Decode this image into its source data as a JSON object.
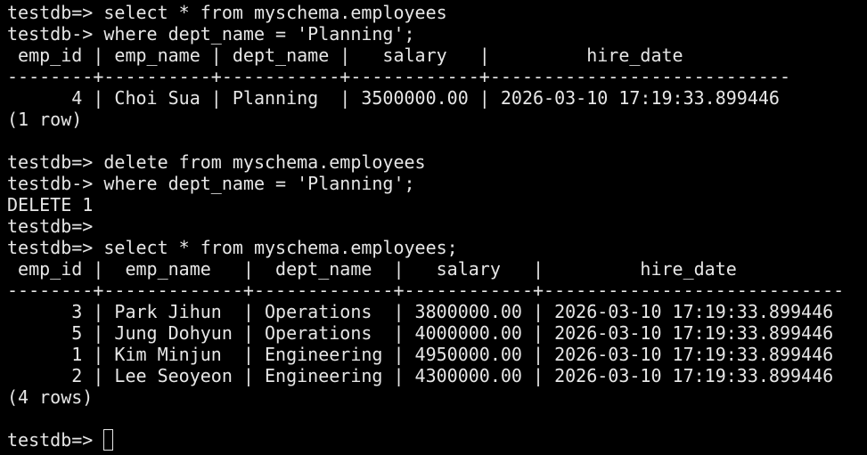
{
  "terminal": {
    "lines": [
      "testdb=> select * from myschema.employees",
      "testdb-> where dept_name = 'Planning';",
      " emp_id | emp_name | dept_name |   salary   |         hire_date",
      "--------+----------+-----------+------------+----------------------------",
      "      4 | Choi Sua | Planning  | 3500000.00 | 2026-03-10 17:19:33.899446",
      "(1 row)",
      "",
      "testdb=> delete from myschema.employees",
      "testdb-> where dept_name = 'Planning';",
      "DELETE 1",
      "testdb=>",
      "testdb=> select * from myschema.employees;",
      " emp_id |  emp_name   |  dept_name  |   salary   |         hire_date",
      "--------+-------------+-------------+------------+----------------------------",
      "      3 | Park Jihun  | Operations  | 3800000.00 | 2026-03-10 17:19:33.899446",
      "      5 | Jung Dohyun | Operations  | 4000000.00 | 2026-03-10 17:19:33.899446",
      "      1 | Kim Minjun  | Engineering | 4950000.00 | 2026-03-10 17:19:33.899446",
      "      2 | Lee Seoyeon | Engineering | 4300000.00 | 2026-03-10 17:19:33.899446",
      "(4 rows)",
      ""
    ],
    "prompt": "testdb=> "
  },
  "colors": {
    "background": "#000000",
    "foreground": "#e6e6e6"
  }
}
